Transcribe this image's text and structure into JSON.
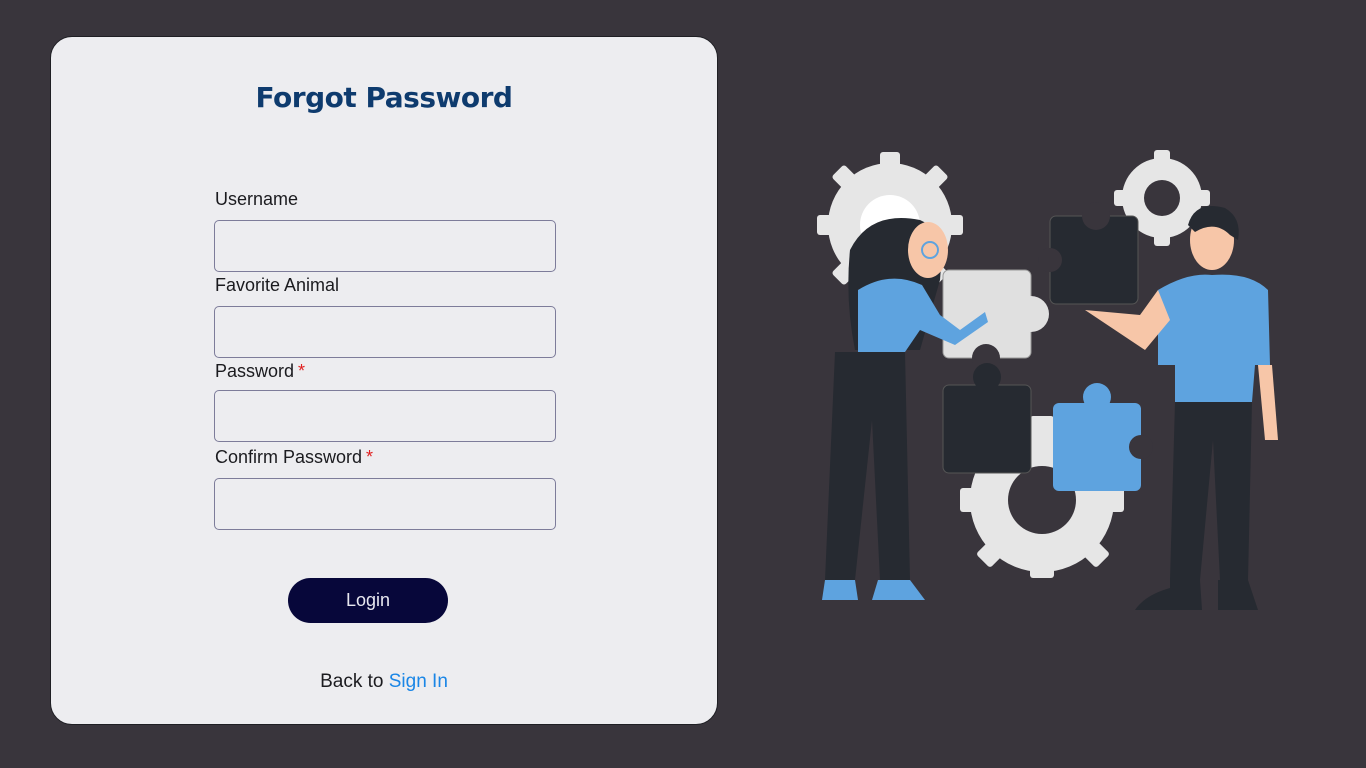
{
  "form": {
    "title": "Forgot Password",
    "fields": [
      {
        "label": "Username",
        "required": false,
        "value": ""
      },
      {
        "label": "Favorite Animal",
        "required": false,
        "value": ""
      },
      {
        "label": "Password",
        "required": true,
        "value": ""
      },
      {
        "label": "Confirm Password",
        "required": true,
        "value": ""
      }
    ],
    "required_mark": "*",
    "submit_label": "Login",
    "back_text": "Back to",
    "back_link": "Sign In"
  },
  "colors": {
    "background": "#39353c",
    "card": "#ededf0",
    "title": "#0e3b6e",
    "button": "#07073a",
    "link": "#1a86e6",
    "required": "#e02020",
    "illustration_blue": "#5ea3df",
    "illustration_dark": "#262a31",
    "illustration_gray": "#e0e0e0"
  },
  "illustration": {
    "icons": [
      "gear-icon",
      "puzzle-piece-icon",
      "woman-figure",
      "man-figure"
    ]
  }
}
